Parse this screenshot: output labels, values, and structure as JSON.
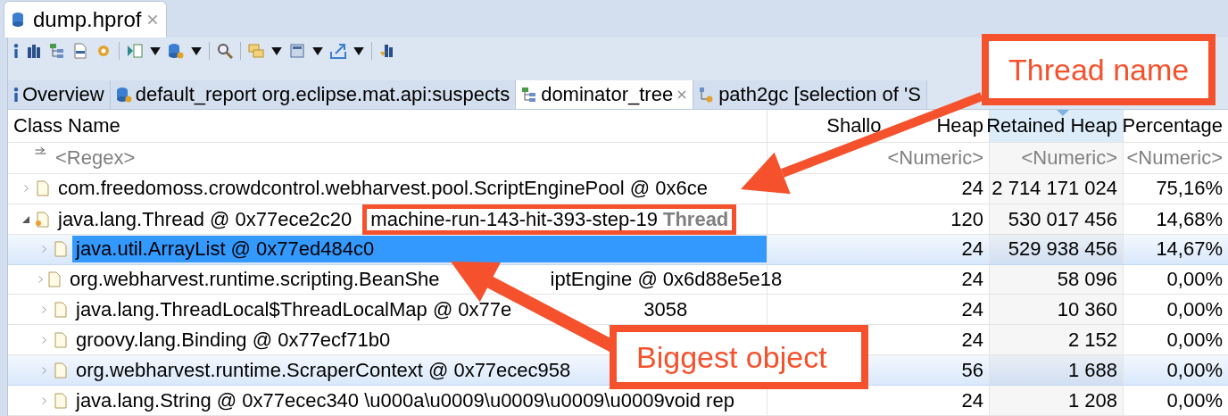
{
  "editor_tab": {
    "label": "dump.hprof",
    "selected": true
  },
  "view_tabs": [
    {
      "label": "Overview",
      "selected": false,
      "closable": false
    },
    {
      "label": "default_report  org.eclipse.mat.api:suspects",
      "selected": false,
      "closable": false
    },
    {
      "label": "dominator_tree",
      "selected": true,
      "closable": true
    },
    {
      "label": "path2gc [selection of 'S",
      "selected": false,
      "closable": false
    }
  ],
  "table": {
    "columns": [
      {
        "label": "Class Name",
        "sorted": false
      },
      {
        "label": "Shallo",
        "label_tail": "Heap",
        "sorted": false
      },
      {
        "label": "Retained Heap",
        "sorted": true
      },
      {
        "label": "Percentage",
        "sorted": false
      }
    ],
    "filters": [
      "<Regex>",
      "<Numeric>",
      "<Numeric>",
      "<Numeric>"
    ],
    "rows": [
      {
        "name": "com.freedomoss.crowdcontrol.webharvest.pool.ScriptEnginePool @ 0x6ce",
        "kind": "object",
        "shallow": "24",
        "retained": "2 714 171 024",
        "percentage": "75,16%",
        "expanded": false,
        "selected": false,
        "highlighted": false
      },
      {
        "name": "java.lang.Thread @ 0x77ece2c20",
        "kind": "thread",
        "label": "machine-run-143-hit-393-step-19",
        "label_type": "Thread",
        "shallow": "120",
        "retained": "530 017 456",
        "percentage": "14,68%",
        "expanded": true,
        "selected": false,
        "highlighted": false,
        "children": [
          {
            "name": "java.util.ArrayList @ 0x77ed484c0",
            "kind": "object",
            "shallow": "24",
            "retained": "529 938 456",
            "percentage": "14,67%",
            "expanded": false,
            "selected": true,
            "highlighted": true
          },
          {
            "name": "org.webharvest.runtime.scripting.BeanShe",
            "name_tail": "iptEngine @ 0x6d88e5e18",
            "kind": "object",
            "shallow": "24",
            "retained": "58 096",
            "percentage": "0,00%",
            "expanded": false,
            "selected": false,
            "highlighted": false
          },
          {
            "name": "java.lang.ThreadLocal$ThreadLocalMap @ 0x77e",
            "name_tail": "3058",
            "kind": "object",
            "shallow": "24",
            "retained": "10 360",
            "percentage": "0,00%",
            "expanded": false,
            "selected": false,
            "highlighted": false
          },
          {
            "name": "groovy.lang.Binding @ 0x77ecf71b0",
            "kind": "object",
            "shallow": "24",
            "retained": "2 152",
            "percentage": "0,00%",
            "expanded": false,
            "selected": false,
            "highlighted": false
          },
          {
            "name": "org.webharvest.runtime.ScraperContext @ 0x77ecec958",
            "kind": "object",
            "shallow": "56",
            "retained": "1 688",
            "percentage": "0,00%",
            "expanded": false,
            "selected": false,
            "highlighted": true
          },
          {
            "name": "java.lang.String @ 0x77ecec340  \\u000a\\u0009\\u0009\\u0009\\u0009void rep",
            "kind": "object",
            "shallow": "24",
            "retained": "1 208",
            "percentage": "0,00%",
            "expanded": false,
            "selected": false,
            "highlighted": false
          }
        ]
      }
    ]
  },
  "annotations": [
    {
      "text": "Thread name"
    },
    {
      "text": "Biggest object"
    }
  ]
}
